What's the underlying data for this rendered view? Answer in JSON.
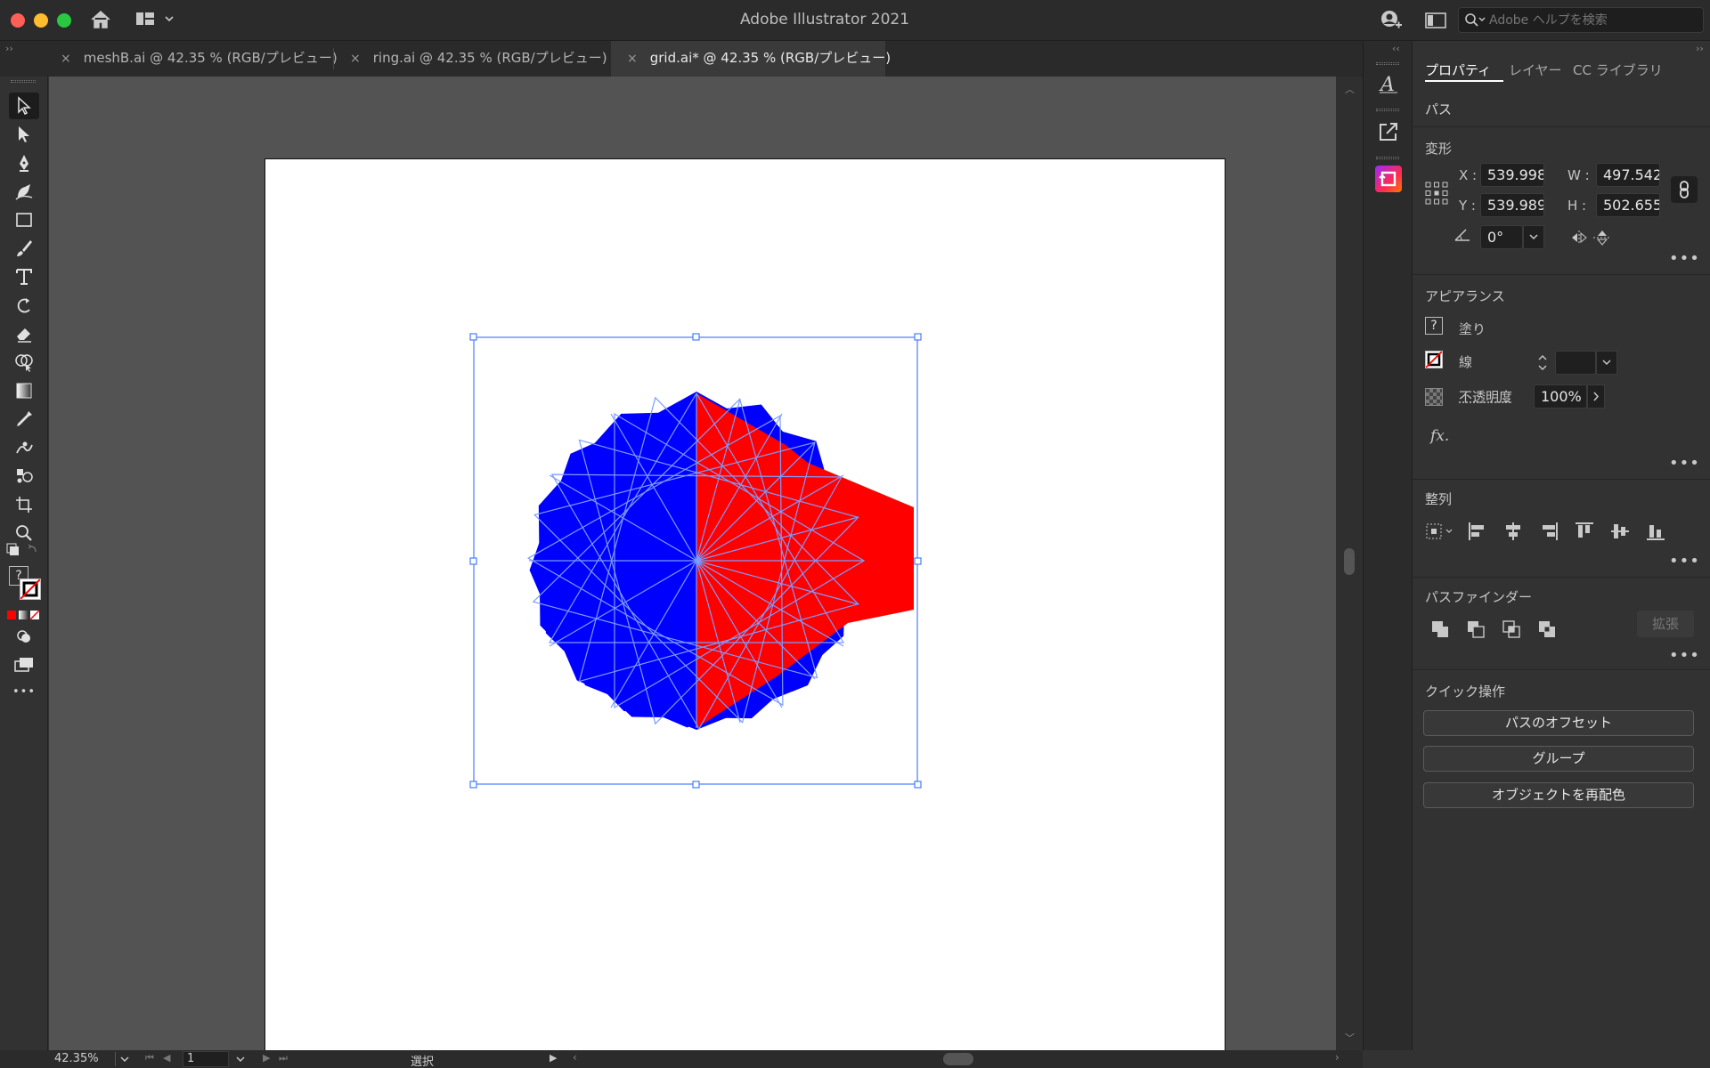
{
  "window": {
    "title": "Adobe Illustrator 2021",
    "help_search_placeholder": "Adobe ヘルプを検索"
  },
  "tabs": [
    {
      "label": "meshB.ai @ 42.35 % (RGB/プレビュー)",
      "close": "×"
    },
    {
      "label": "ring.ai @ 42.35 % (RGB/プレビュー)",
      "close": "×"
    },
    {
      "label": "grid.ai* @ 42.35 % (RGB/プレビュー)",
      "close": "×"
    }
  ],
  "active_tab": 2,
  "tools": [
    "selection-tool",
    "direct-selection-tool",
    "pen-tool",
    "curvature-tool",
    "rectangle-tool",
    "paintbrush-tool",
    "type-tool",
    "rotate-tool",
    "eraser-tool",
    "shape-builder-tool",
    "gradient-tool",
    "eyedropper-tool",
    "puppet-warp-tool",
    "symbol-sprayer-tool",
    "artboard-tool",
    "zoom-tool"
  ],
  "toolbar": {
    "fill_stroke_question": "?",
    "more": "•••"
  },
  "panel": {
    "tabs": [
      "プロパティ",
      "レイヤー",
      "CC ライブラリ"
    ],
    "selection_type": "パス",
    "transform": {
      "title": "変形",
      "x_label": "X :",
      "x_value": "539.998",
      "y_label": "Y :",
      "y_value": "539.989",
      "w_label": "W :",
      "w_value": "497.542",
      "h_label": "H :",
      "h_value": "502.655",
      "angle_value": "0°"
    },
    "appearance": {
      "title": "アピアランス",
      "fill_label": "塗り",
      "fill_swatch": "?",
      "stroke_label": "線",
      "opacity_label": "不透明度",
      "opacity_value": "100%",
      "fx_label": "fx."
    },
    "align": {
      "title": "整列"
    },
    "pathfinder": {
      "title": "パスファインダー",
      "expand_label": "拡張"
    },
    "quick_actions": {
      "title": "クイック操作",
      "buttons": [
        "パスのオフセット",
        "グループ",
        "オブジェクトを再配色"
      ]
    },
    "more": "•••"
  },
  "status": {
    "zoom": "42.35%",
    "artboard_number": "1",
    "tool_status": "選択"
  },
  "colors": {
    "accent_selection": "#4a7bff",
    "shape_blue": "#0000ff",
    "shape_red": "#ff0000",
    "traffic_red": "#ff5f57",
    "traffic_yellow": "#febc2e",
    "traffic_green": "#28c840"
  }
}
